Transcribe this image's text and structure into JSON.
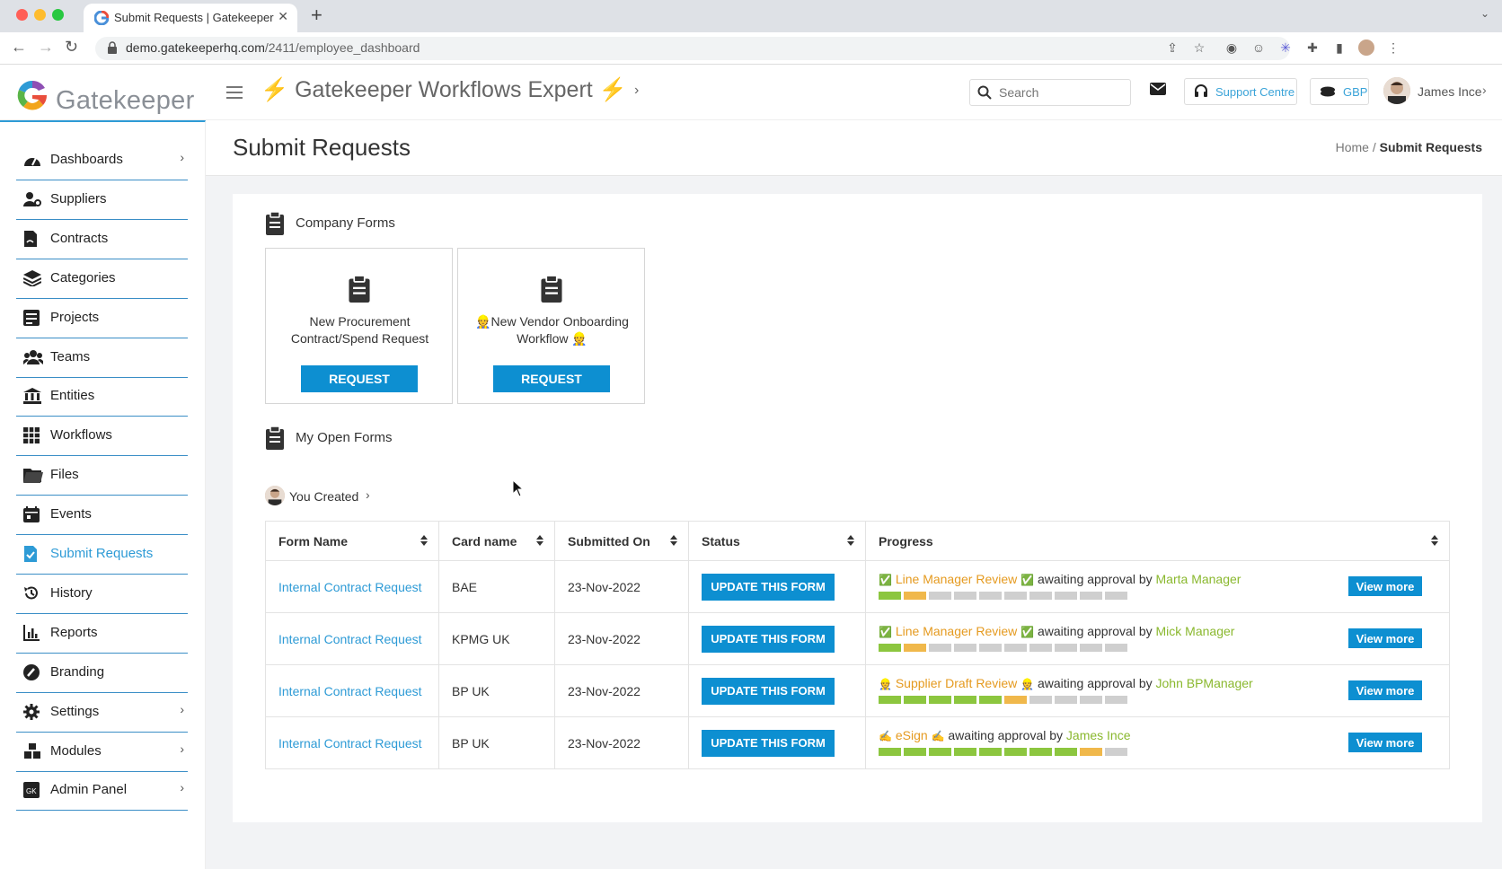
{
  "browser": {
    "tab_title": "Submit Requests | Gatekeeper",
    "url_host": "demo.gatekeeperhq.com",
    "url_path": "/2411/employee_dashboard"
  },
  "header": {
    "logo_text": "Gatekeeper",
    "workspace": "Gatekeeper Workflows Expert",
    "search_placeholder": "Search",
    "support_label": "Support Centre",
    "currency": "GBP",
    "user_name": "James Ince"
  },
  "sidebar": {
    "items": [
      {
        "label": "Dashboards",
        "icon": "gauge-icon",
        "has_chevron": true
      },
      {
        "label": "Suppliers",
        "icon": "user-cog-icon",
        "has_chevron": false
      },
      {
        "label": "Contracts",
        "icon": "contract-icon",
        "has_chevron": false
      },
      {
        "label": "Categories",
        "icon": "layers-icon",
        "has_chevron": false
      },
      {
        "label": "Projects",
        "icon": "projects-icon",
        "has_chevron": false
      },
      {
        "label": "Teams",
        "icon": "users-icon",
        "has_chevron": false
      },
      {
        "label": "Entities",
        "icon": "bank-icon",
        "has_chevron": false
      },
      {
        "label": "Workflows",
        "icon": "grid-icon",
        "has_chevron": false
      },
      {
        "label": "Files",
        "icon": "folder-icon",
        "has_chevron": false
      },
      {
        "label": "Events",
        "icon": "calendar-icon",
        "has_chevron": false
      },
      {
        "label": "Submit Requests",
        "icon": "file-check-icon",
        "has_chevron": false,
        "active": true
      },
      {
        "label": "History",
        "icon": "history-icon",
        "has_chevron": false
      },
      {
        "label": "Reports",
        "icon": "bar-chart-icon",
        "has_chevron": false
      },
      {
        "label": "Branding",
        "icon": "palette-icon",
        "has_chevron": false
      },
      {
        "label": "Settings",
        "icon": "gear-icon",
        "has_chevron": true
      },
      {
        "label": "Modules",
        "icon": "cubes-icon",
        "has_chevron": true
      },
      {
        "label": "Admin Panel",
        "icon": "gk-icon",
        "has_chevron": true
      }
    ]
  },
  "page": {
    "title": "Submit Requests",
    "breadcrumb_home": "Home",
    "breadcrumb_sep": "/",
    "breadcrumb_current": "Submit Requests"
  },
  "company_forms": {
    "heading": "Company Forms",
    "cards": [
      {
        "name_line1": "New Procurement",
        "name_line2": "Contract/Spend Request",
        "button": "REQUEST"
      },
      {
        "name_line1": "👷New Vendor Onboarding",
        "name_line2": "Workflow 👷",
        "button": "REQUEST"
      }
    ]
  },
  "open_forms": {
    "heading": "My Open Forms",
    "filter_label": "You Created",
    "columns": [
      "Form Name",
      "Card name",
      "Submitted On",
      "Status",
      "Progress"
    ],
    "rows": [
      {
        "form_name": "Internal Contract Request",
        "card_name": "BAE",
        "submitted_on": "23-Nov-2022",
        "status_button": "UPDATE THIS FORM",
        "stage_prefix": "✅",
        "stage": "Line Manager Review",
        "stage_suffix": "✅",
        "awaiting": "awaiting approval by",
        "approver": "Marta Manager",
        "progress": {
          "total": 10,
          "done": 1,
          "current": 2
        },
        "view_more": "View more"
      },
      {
        "form_name": "Internal Contract Request",
        "card_name": "KPMG UK",
        "submitted_on": "23-Nov-2022",
        "status_button": "UPDATE THIS FORM",
        "stage_prefix": "✅",
        "stage": "Line Manager Review",
        "stage_suffix": "✅",
        "awaiting": "awaiting approval by",
        "approver": "Mick Manager",
        "progress": {
          "total": 10,
          "done": 1,
          "current": 2
        },
        "view_more": "View more"
      },
      {
        "form_name": "Internal Contract Request",
        "card_name": "BP UK",
        "submitted_on": "23-Nov-2022",
        "status_button": "UPDATE THIS FORM",
        "stage_prefix": "👷",
        "stage": "Supplier Draft Review",
        "stage_suffix": "👷",
        "awaiting": "awaiting approval by",
        "approver": "John BPManager",
        "progress": {
          "total": 10,
          "done": 5,
          "current": 6
        },
        "view_more": "View more"
      },
      {
        "form_name": "Internal Contract Request",
        "card_name": "BP UK",
        "submitted_on": "23-Nov-2022",
        "status_button": "UPDATE THIS FORM",
        "stage_prefix": "✍",
        "stage": "eSign",
        "stage_suffix": "✍",
        "awaiting": "awaiting approval by",
        "approver": "James Ince",
        "progress": {
          "total": 10,
          "done": 8,
          "current": 9
        },
        "view_more": "View more"
      }
    ]
  },
  "colors": {
    "accent": "#2e9bd6",
    "button": "#0d8fd1",
    "progress_done": "#8cc63f",
    "progress_current": "#f0b84b",
    "progress_pending": "#cfcfcf",
    "stage_text": "#e59a1f",
    "approver_text": "#8ab82e"
  }
}
